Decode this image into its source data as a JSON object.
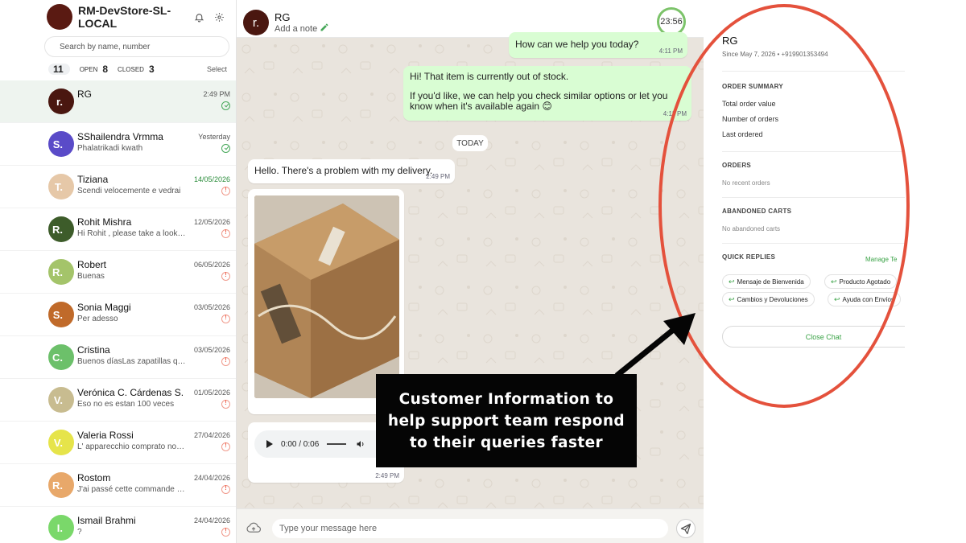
{
  "store": {
    "name": "RM-DevStore-SL-LOCAL"
  },
  "search": {
    "placeholder": "Search by name, number"
  },
  "filters": {
    "all_count": "11",
    "open_label": "OPEN",
    "open_count": "8",
    "closed_label": "CLOSED",
    "closed_count": "3",
    "select_label": "Select"
  },
  "conversations": [
    {
      "initial": "r.",
      "color": "#4a1710",
      "name": "RG",
      "preview": "",
      "date": "2:49 PM",
      "status": "ok",
      "date_green": false
    },
    {
      "initial": "S.",
      "color": "#5a4bc8",
      "name": "SShailendra Vrmma",
      "preview": "Phalatrikadi kwath",
      "date": "Yesterday",
      "status": "ok",
      "date_green": false
    },
    {
      "initial": "T.",
      "color": "#e6c8a8",
      "name": "Tiziana",
      "preview": "Scendi velocemente e vedrai",
      "date": "14/05/2026",
      "status": "warn",
      "date_green": true
    },
    {
      "initial": "R.",
      "color": "#3d5c2a",
      "name": "Rohit Mishra",
      "preview": "Hi Rohit , please take a look at this",
      "date": "12/05/2026",
      "status": "warn",
      "date_green": false
    },
    {
      "initial": "R.",
      "color": "#a4c46a",
      "name": "Robert",
      "preview": "Buenas",
      "date": "06/05/2026",
      "status": "warn",
      "date_green": false
    },
    {
      "initial": "S.",
      "color": "#c06a2a",
      "name": "Sonia Maggi",
      "preview": "Per adesso",
      "date": "03/05/2026",
      "status": "warn",
      "date_green": false
    },
    {
      "initial": "C.",
      "color": "#6cc06a",
      "name": "Cristina",
      "preview": "Buenos díasLas zapatillas que pedí",
      "date": "03/05/2026",
      "status": "warn",
      "date_green": false
    },
    {
      "initial": "V.",
      "color": "#c8bc90",
      "name": "Verónica C. Cárdenas S.",
      "preview": "Eso no es estan 100 veces",
      "date": "01/05/2026",
      "status": "warn",
      "date_green": false
    },
    {
      "initial": "V.",
      "color": "#e6e44a",
      "name": "Valeria Rossi",
      "preview": "L' apparecchio comprato non funziona",
      "date": "27/04/2026",
      "status": "warn",
      "date_green": false
    },
    {
      "initial": "R.",
      "color": "#e8a86a",
      "name": "Rostom",
      "preview": "J'ai passé cette commande hier",
      "date": "24/04/2026",
      "status": "warn",
      "date_green": false
    },
    {
      "initial": "I.",
      "color": "#7ad86a",
      "name": "Ismail Brahmi",
      "preview": "?",
      "date": "24/04/2026",
      "status": "warn",
      "date_green": false
    }
  ],
  "chat": {
    "avatar_initial": "r.",
    "name": "RG",
    "note_label": "Add a note",
    "timer": "23:56",
    "msg1": {
      "text": "How can we help you today?",
      "time": "4:11 PM"
    },
    "msg2": {
      "line1": "Hi! That item is currently out of stock.",
      "line2": "If you'd like, we can help you check similar options or let you know when it's available again 😊",
      "time": "4:11 PM"
    },
    "today_label": "TODAY",
    "msg3": {
      "text": "Hello. There's a problem with my delivery.",
      "time": "2:49 PM"
    },
    "audio": {
      "time": "0:00 / 0:06",
      "time_sent": "2:49 PM"
    },
    "composer_placeholder": "Type your message here"
  },
  "panel": {
    "name": "RG",
    "since": "Since May 7, 2026 • +919901353494",
    "order_summary_title": "ORDER SUMMARY",
    "total_order_value": "Total order value",
    "number_of_orders": "Number of orders",
    "last_ordered": "Last ordered",
    "orders_title": "ORDERS",
    "no_recent_orders": "No recent orders",
    "abandoned_carts_title": "ABANDONED CARTS",
    "no_abandoned_carts": "No abandoned carts",
    "quick_replies_title": "QUICK REPLIES",
    "manage_label": "Manage Te",
    "quick_replies": [
      "Mensaje de Bienvenida",
      "Producto Agotado",
      "Cambios y Devoluciones",
      "Ayuda con Envíos"
    ],
    "close_chat_label": "Close Chat"
  },
  "annotation": {
    "callout_text": "Customer Information to help support team respond to their queries faster",
    "highlight_color": "#e4513c"
  }
}
